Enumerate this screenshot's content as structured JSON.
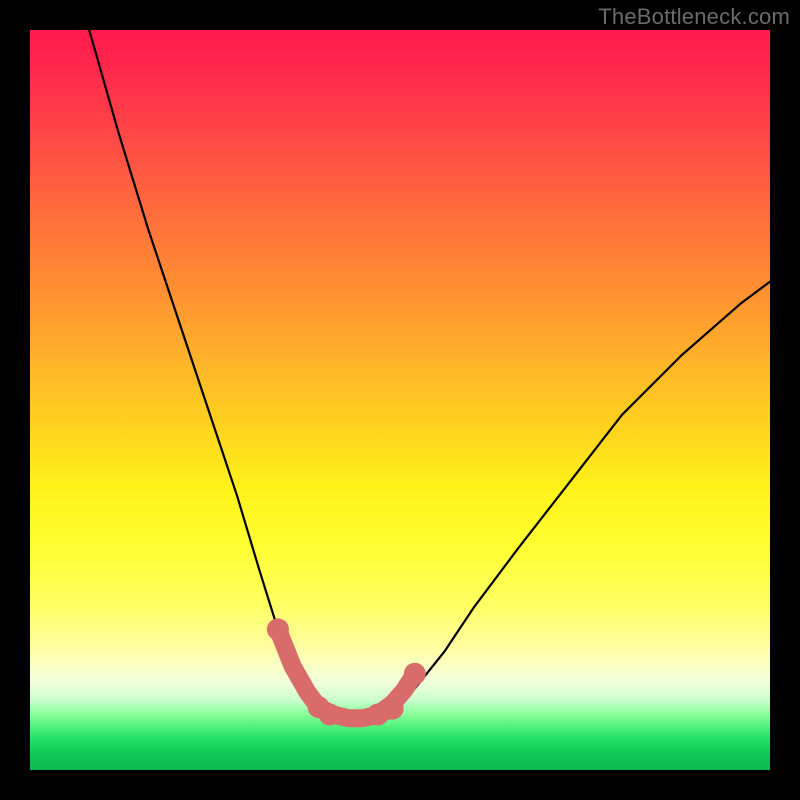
{
  "watermark": "TheBottleneck.com",
  "chart_data": {
    "type": "line",
    "title": "",
    "xlabel": "",
    "ylabel": "",
    "xlim": [
      0,
      100
    ],
    "ylim": [
      0,
      100
    ],
    "grid": false,
    "series": [
      {
        "name": "bottleneck-curve",
        "color": "#000000",
        "x": [
          8,
          12,
          16,
          20,
          24,
          28,
          31,
          33.5,
          35.5,
          37.5,
          39,
          40.5,
          42,
          45,
          48,
          52,
          56,
          60,
          66,
          73,
          80,
          88,
          96,
          100
        ],
        "y": [
          100,
          86,
          73,
          61,
          49,
          37,
          27,
          19,
          14,
          10.5,
          8.5,
          7.5,
          7,
          7,
          8,
          11,
          16,
          22,
          30,
          39,
          48,
          56,
          63,
          66
        ]
      },
      {
        "name": "optimal-region-left",
        "type": "marker-band",
        "color": "#d96b6b",
        "x": [
          33.5,
          35.5,
          37.5,
          39,
          40.5
        ],
        "y": [
          19,
          14,
          10.5,
          8.5,
          7.5
        ]
      },
      {
        "name": "optimal-region-bottom",
        "type": "marker-band",
        "color": "#d96b6b",
        "x": [
          39,
          41,
          43,
          45,
          47,
          49
        ],
        "y": [
          8.5,
          7.5,
          7,
          7,
          7.5,
          8.3
        ]
      },
      {
        "name": "optimal-region-right",
        "type": "marker-band",
        "color": "#d96b6b",
        "x": [
          47,
          49,
          50.5,
          52
        ],
        "y": [
          7.5,
          9,
          10.7,
          13
        ]
      }
    ],
    "gradient_stops": [
      {
        "pos": 0.0,
        "color": "#ff1a4d"
      },
      {
        "pos": 0.34,
        "color": "#ff8c33"
      },
      {
        "pos": 0.62,
        "color": "#fff21a"
      },
      {
        "pos": 0.86,
        "color": "#ffffaa"
      },
      {
        "pos": 0.93,
        "color": "#88ff99"
      },
      {
        "pos": 1.0,
        "color": "#0db94f"
      }
    ]
  }
}
